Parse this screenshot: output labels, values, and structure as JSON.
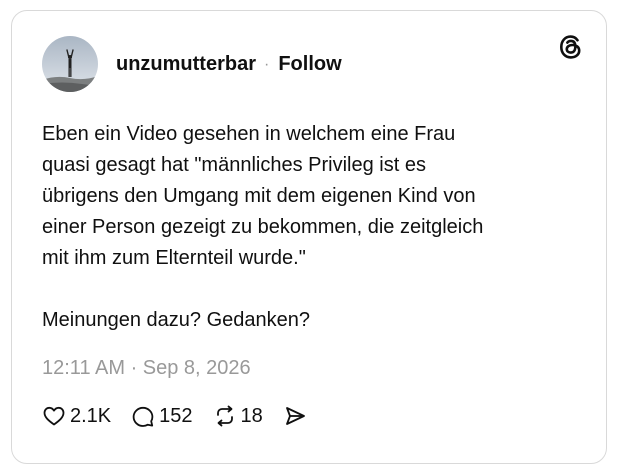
{
  "post": {
    "username": "unzumutterbar",
    "separator": "·",
    "follow_label": "Follow",
    "text_lines": [
      "Eben ein Video gesehen in welchem eine Frau",
      "quasi gesagt hat \"männliches Privileg ist es",
      "übrigens den Umgang mit dem eigenen Kind von",
      "einer Person gezeigt zu bekommen, die zeitgleich",
      "mit ihm zum Elternteil wurde.\""
    ],
    "question": "Meinungen dazu? Gedanken?",
    "timestamp": "12:11 AM · Sep 8, 2026"
  },
  "actions": {
    "likes": "2.1K",
    "replies": "152",
    "reposts": "18"
  },
  "icons": {
    "logo": "threads-logo-icon",
    "like": "heart-icon",
    "reply": "speech-bubble-icon",
    "repost": "repost-icon",
    "share": "send-icon"
  }
}
